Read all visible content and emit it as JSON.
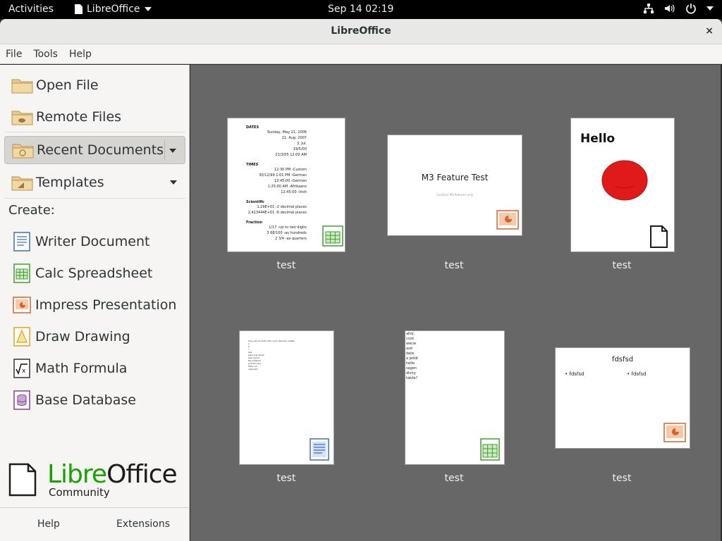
{
  "topbar": {
    "activities": "Activities",
    "app_name": "LibreOffice",
    "clock": "Sep 14  02:19"
  },
  "window": {
    "title": "LibreOffice",
    "close": "×"
  },
  "menubar": {
    "items": [
      "File",
      "Tools",
      "Help"
    ]
  },
  "sidebar": {
    "open_file": "Open File",
    "remote_files": "Remote Files",
    "recent_documents": "Recent Documents",
    "templates": "Templates",
    "create_label": "Create:",
    "create": [
      {
        "label": "Writer Document",
        "icon": "writer-icon",
        "color": "#3b6fc4"
      },
      {
        "label": "Calc Spreadsheet",
        "icon": "calc-icon",
        "color": "#3f9f2c"
      },
      {
        "label": "Impress Presentation",
        "icon": "impress-icon",
        "color": "#d8622a"
      },
      {
        "label": "Draw Drawing",
        "icon": "draw-icon",
        "color": "#e2a21a"
      },
      {
        "label": "Math Formula",
        "icon": "math-icon",
        "color": "#333333"
      },
      {
        "label": "Base Database",
        "icon": "base-icon",
        "color": "#8a3d9c"
      }
    ],
    "brand": {
      "libre": "Libre",
      "office": "Office",
      "community": "Community"
    },
    "help": "Help",
    "extensions": "Extensions"
  },
  "recent": [
    {
      "caption": "test",
      "type": "calc",
      "content": {
        "sections": [
          {
            "heading": "DATES",
            "lines": [
              "Sunday, May 21, 2006",
              "21. Aug. 2007",
              "3. Jul.",
              "19/5/00",
              "21/3/05 12:00 AM"
            ]
          },
          {
            "heading": "TIMES",
            "lines": [
              "12:30 PM ‹Custom",
              "30/12/99 1:01 PM ‹German",
              "13:45:00 ‹German",
              "1:25:00 AM ‹Afrikaans",
              "12:45:00 ‹Irish"
            ]
          },
          {
            "heading": "Scientific",
            "lines": [
              "1.29E+01 ‹2 decimal places",
              "2,423444E+01 ‹6 decimal places"
            ]
          },
          {
            "heading": "Fraction",
            "lines": [
              "1/17 ‹up to two digits",
              "3 68/100 ‹as hundreds",
              "2 3/4 ‹as quarters"
            ]
          }
        ]
      }
    },
    {
      "caption": "test",
      "type": "impress",
      "content": {
        "title": "M3 Feature Test",
        "subtitle": "Contains M3 features only"
      }
    },
    {
      "caption": "test",
      "type": "draw",
      "content": {
        "title": "Hello"
      }
    },
    {
      "caption": "test",
      "type": "writer",
      "content": {
        "lines": [
          "Ahoj, jak se máš? Tuto vodu dolovat, nedělá",
          "a",
          "b",
          "c",
          "dsa",
          "Jakosi jaj zkusit",
          "Jako zkusit",
          "Novodobost",
          "pokračování",
          "Mohu se",
          "odpověď"
        ]
      }
    },
    {
      "caption": "test",
      "type": "calc",
      "content": {
        "lines": [
          "ahoj",
          "cvoc",
          "wecw",
          "asd",
          "dalsi",
          "a ještě",
          "hello",
          "sagen",
          "divny",
          "takže?"
        ]
      }
    },
    {
      "caption": "test",
      "type": "impress",
      "content": {
        "title": "fdsfsd",
        "bullet_left": "• fdsfsd",
        "bullet_right": "• fdsfsd"
      }
    }
  ]
}
